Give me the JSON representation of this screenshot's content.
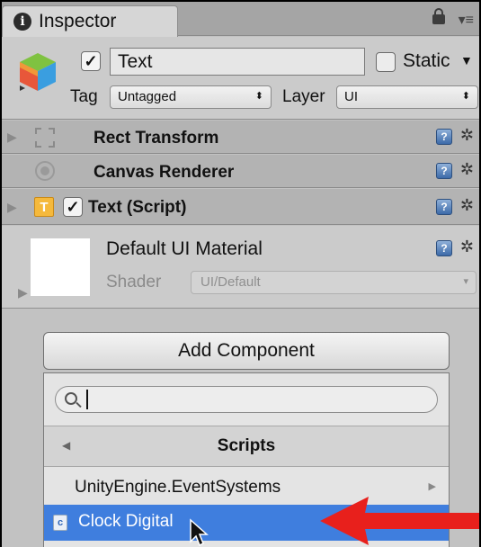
{
  "tab": {
    "title": "Inspector",
    "info_glyph": "i"
  },
  "header": {
    "name_value": "Text",
    "active_checked": "✓",
    "static_label": "Static",
    "static_arrow": "▼",
    "tag_label": "Tag",
    "tag_value": "Untagged",
    "layer_label": "Layer",
    "layer_value": "UI",
    "caret": "⬍"
  },
  "components": [
    {
      "title": "Rect Transform",
      "icon": "rect-transform-icon"
    },
    {
      "title": "Canvas Renderer",
      "icon": "canvas-renderer-icon"
    },
    {
      "title": "Text (Script)",
      "icon": "text-script-icon",
      "icon_letter": "T",
      "checked": "✓"
    }
  ],
  "material": {
    "title": "Default UI Material",
    "shader_label": "Shader",
    "shader_value": "UI/Default",
    "caret": "▾"
  },
  "add_component": {
    "button_label": "Add Component",
    "search_value": "",
    "scripts_title": "Scripts",
    "items": [
      {
        "label": "UnityEngine.EventSystems",
        "has_submenu": true
      },
      {
        "label": "Clock Digital",
        "selected": true
      }
    ],
    "script_icon_glyph": "c"
  },
  "glyphs": {
    "fold": "▶",
    "gear": "✲",
    "help": "?",
    "back": "◀",
    "sub": "▶",
    "menu": "▾≡"
  },
  "colors": {
    "selection": "#3f7ede",
    "annotation_arrow": "#e8201c",
    "text_icon": "#f5b93c"
  }
}
